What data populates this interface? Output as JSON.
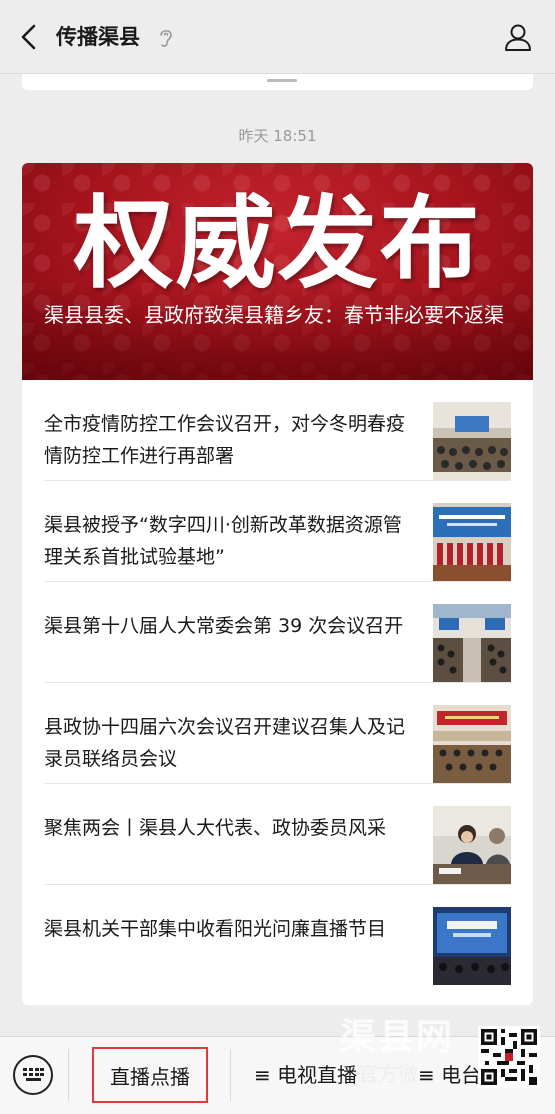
{
  "header": {
    "title": "传播渠县",
    "back_icon": "back-chevron-icon",
    "listen_icon": "ear-icon",
    "profile_icon": "person-icon"
  },
  "timestamp": "昨天 18:51",
  "hero": {
    "big_word": "权威发布",
    "caption": "渠县县委、县政府致渠县籍乡友：春节非必要不返渠",
    "colors": {
      "bg": "#a5131d",
      "text": "#ffffff"
    }
  },
  "articles": [
    {
      "title": "全市疫情防控工作会议召开，对今冬明春疫情防控工作进行再部署",
      "thumb": "meeting-hall"
    },
    {
      "title": "渠县被授予“数字四川·创新改革数据资源管理关系首批试验基地”",
      "thumb": "award-stage"
    },
    {
      "title": "渠县第十八届人大常委会第 39 次会议召开",
      "thumb": "conference-room"
    },
    {
      "title": "县政协十四届六次会议召开建议召集人及记录员联络员会议",
      "thumb": "red-banner-meeting"
    },
    {
      "title": "聚焦两会丨渠县人大代表、政协委员风采",
      "thumb": "portrait"
    },
    {
      "title": "渠县机关干部集中收看阳光问廉直播节目",
      "thumb": "tv-screen"
    }
  ],
  "menu": {
    "keyboard_icon": "keyboard-icon",
    "items": [
      {
        "label": "直播点播"
      },
      {
        "label": "≡ 电视直播"
      },
      {
        "label": "≡ 电台"
      }
    ]
  },
  "watermark": {
    "line1": "渠县网",
    "line2": "官方微"
  },
  "colors": {
    "accent_border": "#e03a3a",
    "page_bg": "#ededed"
  }
}
